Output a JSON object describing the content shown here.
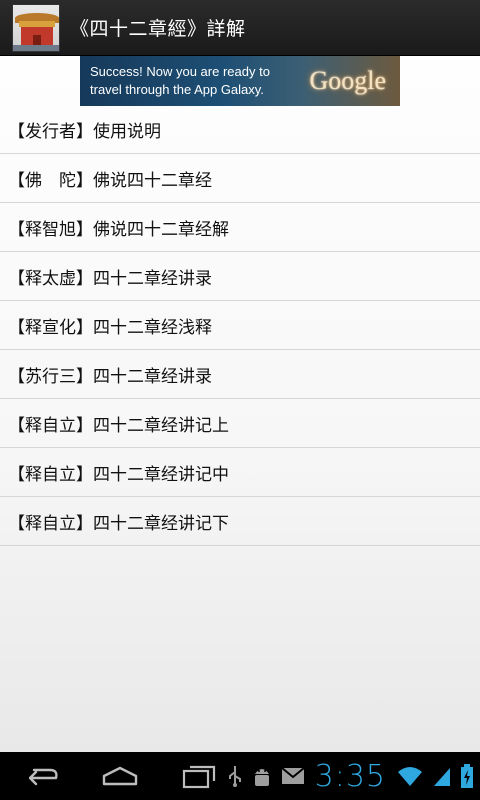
{
  "header": {
    "title": "《四十二章經》詳解",
    "icon": "temple-icon"
  },
  "ad": {
    "line1": "Success! Now you are ready to",
    "line2": "travel through the App Galaxy.",
    "logo": "Google"
  },
  "list": {
    "items": [
      {
        "label": "【发行者】使用说明"
      },
      {
        "label": "【佛　陀】佛说四十二章经"
      },
      {
        "label": "【释智旭】佛说四十二章经解"
      },
      {
        "label": "【释太虚】四十二章经讲录"
      },
      {
        "label": "【释宣化】四十二章经浅释"
      },
      {
        "label": "【苏行三】四十二章经讲录"
      },
      {
        "label": "【释自立】四十二章经讲记上"
      },
      {
        "label": "【释自立】四十二章经讲记中"
      },
      {
        "label": "【释自立】四十二章经讲记下"
      }
    ]
  },
  "nav": {
    "back_icon": "back-icon",
    "home_icon": "home-icon",
    "recents_icon": "recents-icon"
  },
  "status": {
    "time": "3:35",
    "icons": [
      "usb-icon",
      "android-debug-icon",
      "gmail-icon",
      "wifi-icon",
      "signal-icon",
      "battery-charging-icon"
    ]
  },
  "colors": {
    "action_bar": "#1f1f1f",
    "clock": "#2fa8df",
    "divider": "#d6d6d6"
  }
}
